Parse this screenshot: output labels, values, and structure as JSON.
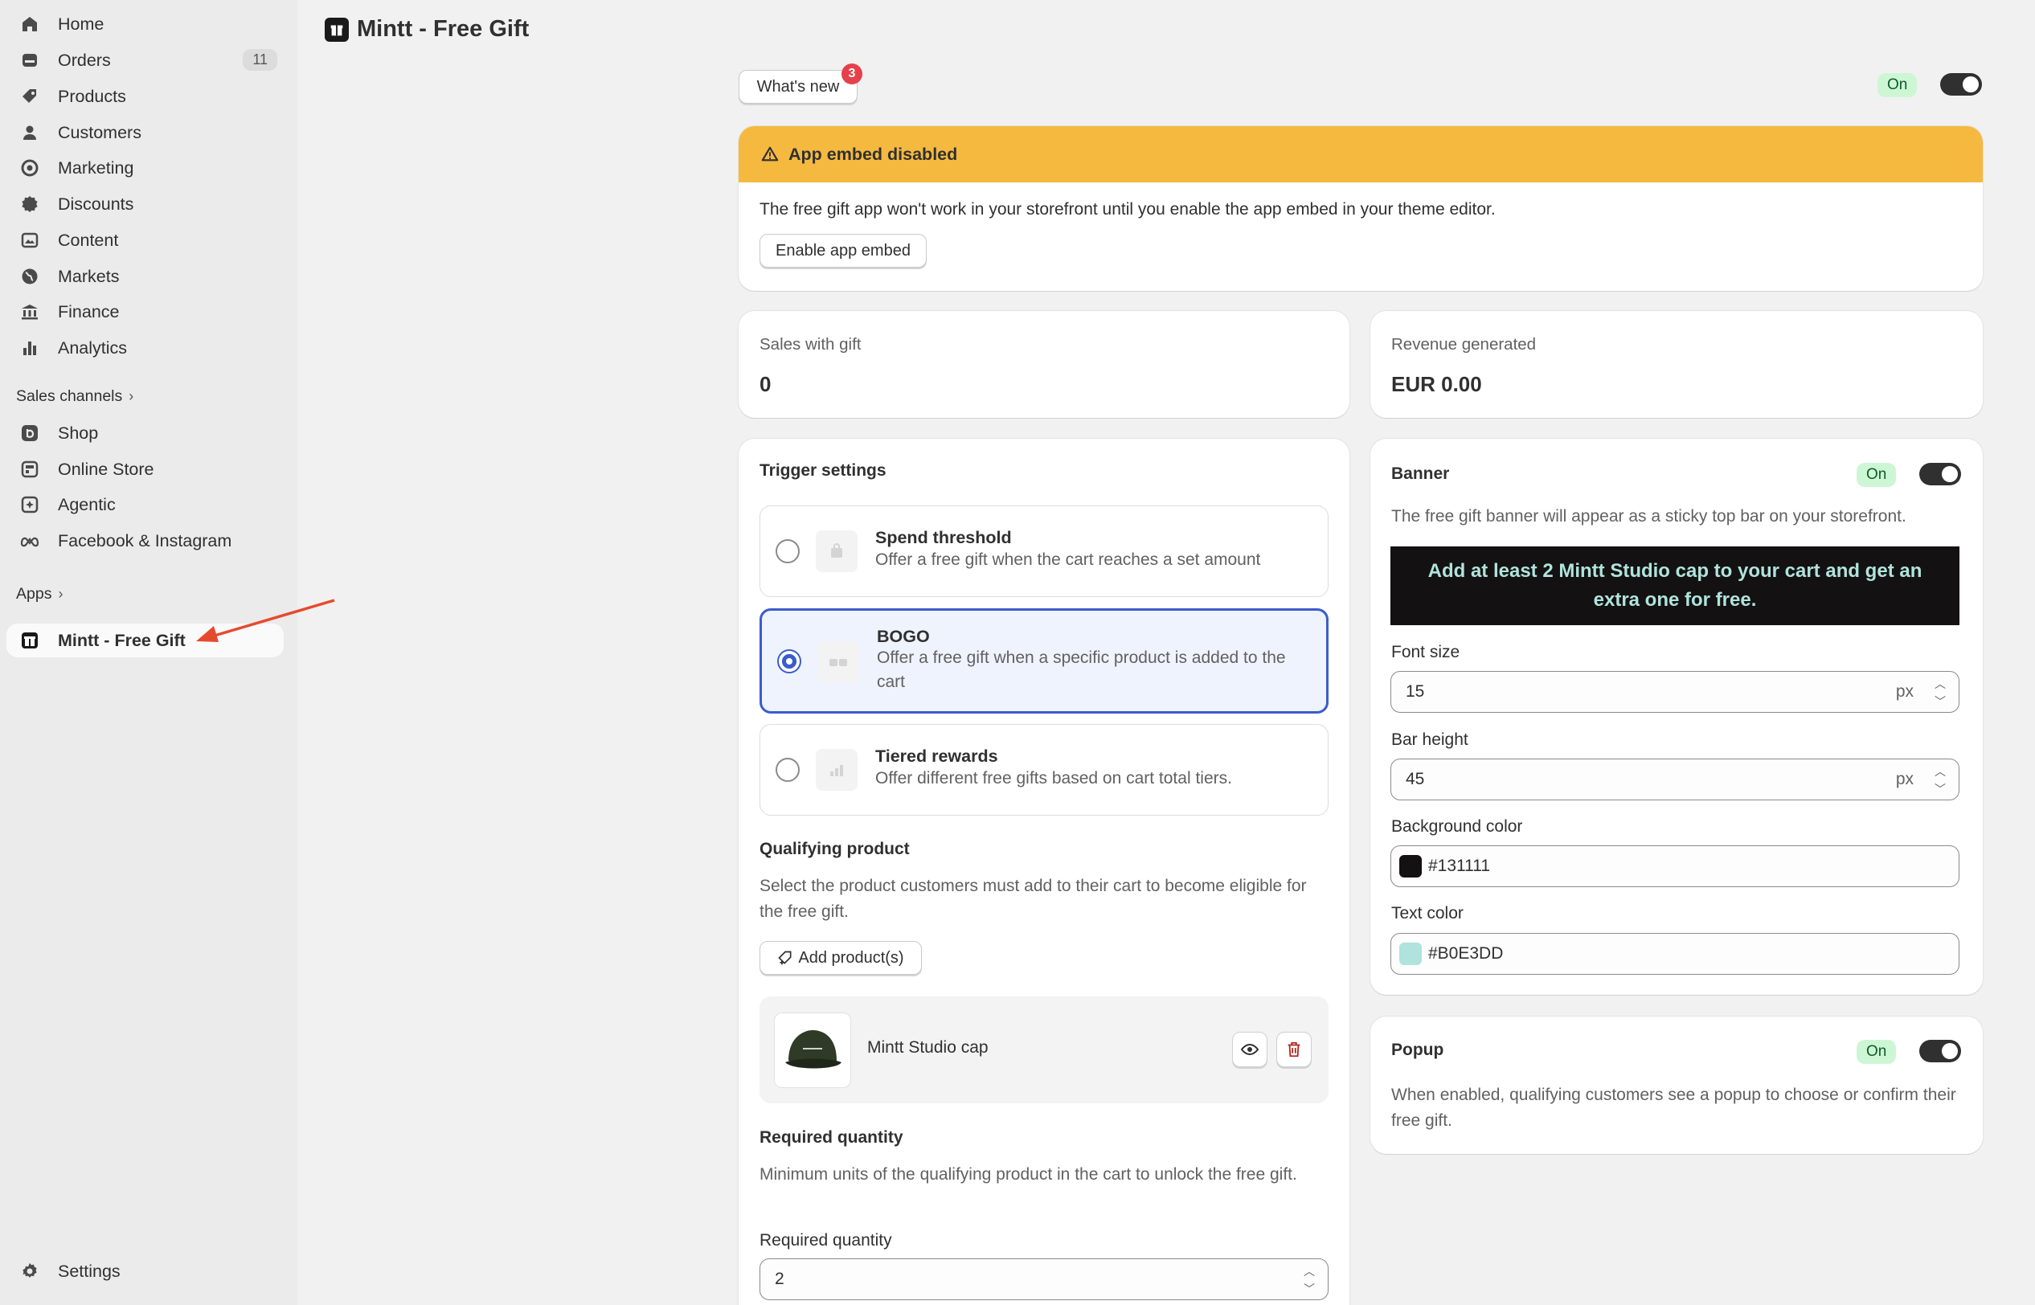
{
  "sidebar": {
    "items": [
      {
        "label": "Home",
        "icon": "home-icon"
      },
      {
        "label": "Orders",
        "icon": "orders-icon",
        "count": "11"
      },
      {
        "label": "Products",
        "icon": "tag-icon"
      },
      {
        "label": "Customers",
        "icon": "person-icon"
      },
      {
        "label": "Marketing",
        "icon": "target-icon"
      },
      {
        "label": "Discounts",
        "icon": "discount-icon"
      },
      {
        "label": "Content",
        "icon": "content-icon"
      },
      {
        "label": "Markets",
        "icon": "globe-icon"
      },
      {
        "label": "Finance",
        "icon": "bank-icon"
      },
      {
        "label": "Analytics",
        "icon": "bar-chart-icon"
      }
    ],
    "sales_channels_label": "Sales channels",
    "channels": [
      {
        "label": "Shop",
        "icon": "shop-icon"
      },
      {
        "label": "Online Store",
        "icon": "store-icon"
      },
      {
        "label": "Agentic",
        "icon": "agentic-icon"
      },
      {
        "label": "Facebook & Instagram",
        "icon": "meta-icon"
      }
    ],
    "apps_label": "Apps",
    "active_app": "Mintt - Free Gift",
    "settings_label": "Settings"
  },
  "header": {
    "title": "Mintt - Free Gift"
  },
  "top": {
    "whats_new_label": "What's new",
    "whats_new_count": "3",
    "status": "On"
  },
  "embed_warning": {
    "title": "App embed disabled",
    "body": "The free gift app won't work in your storefront until you enable the app embed in your theme editor.",
    "button": "Enable app embed"
  },
  "stats": {
    "sales_label": "Sales with gift",
    "sales_value": "0",
    "revenue_label": "Revenue generated",
    "revenue_value": "EUR 0.00"
  },
  "trigger": {
    "heading": "Trigger settings",
    "options": [
      {
        "title": "Spend threshold",
        "desc": "Offer a free gift when the cart reaches a set amount",
        "selected": false
      },
      {
        "title": "BOGO",
        "desc": "Offer a free gift when a specific product is added to the cart",
        "selected": true
      },
      {
        "title": "Tiered rewards",
        "desc": "Offer different free gifts based on cart total tiers.",
        "selected": false
      }
    ],
    "qualifying_heading": "Qualifying product",
    "qualifying_desc": "Select the product customers must add to their cart to become eligible for the free gift.",
    "add_products_label": "Add product(s)",
    "product_name": "Mintt Studio cap",
    "required_heading": "Required quantity",
    "required_desc": "Minimum units of the qualifying product in the cart to unlock the free gift.",
    "required_label": "Required quantity",
    "required_value": "2"
  },
  "banner": {
    "heading": "Banner",
    "status": "On",
    "desc": "The free gift banner will appear as a sticky top bar on your storefront.",
    "preview_text": "Add at least 2 Mintt Studio cap to your cart and get an extra one for free.",
    "font_size_label": "Font size",
    "font_size_value": "15",
    "bar_height_label": "Bar height",
    "bar_height_value": "45",
    "unit": "px",
    "bg_color_label": "Background color",
    "bg_color_value": "#131111",
    "text_color_label": "Text color",
    "text_color_value": "#B0E3DD"
  },
  "popup": {
    "heading": "Popup",
    "status": "On",
    "desc": "When enabled, qualifying customers see a popup to choose or confirm their free gift."
  },
  "colors": {
    "accent": "#3b5ccc",
    "warning": "#f5b940",
    "banner_bg": "#131111",
    "banner_text": "#b0e3dd",
    "arrow": "#e64a2e"
  }
}
